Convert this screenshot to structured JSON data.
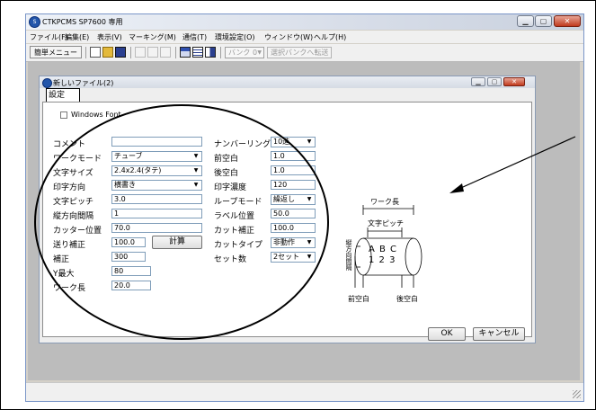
{
  "window": {
    "title": "CTKPCMS SP7600 専用",
    "controls": {
      "minimize": "▁",
      "maximize": "▢",
      "close": "✕"
    }
  },
  "menu": [
    "ファイル(F)",
    "編集(E)",
    "表示(V)",
    "マーキング(M)",
    "通信(T)",
    "環境設定(O)",
    "ウィンドウ(W)",
    "ヘルプ(H)"
  ],
  "toolbar": {
    "simple_menu": "簡単メニュー",
    "bank_select": "バンク 0",
    "transfer_button": "選択バンクへ転送"
  },
  "child_window": {
    "title": "新しいファイル(2)"
  },
  "tab": {
    "label": "設定"
  },
  "font_option": {
    "label": "Windows Font",
    "checked": false
  },
  "fields_left": [
    {
      "label": "コメント",
      "value": "",
      "kind": "text"
    },
    {
      "label": "ワークモード",
      "value": "チューブ",
      "kind": "select"
    },
    {
      "label": "文字サイズ",
      "value": "2.4x2.4(タテ)",
      "kind": "select"
    },
    {
      "label": "印字方向",
      "value": "横書き",
      "kind": "select"
    },
    {
      "label": "文字ピッチ",
      "value": "3.0",
      "kind": "text"
    },
    {
      "label": "縦方向間隔",
      "value": "1",
      "kind": "text"
    },
    {
      "label": "カッター位置",
      "value": "70.0",
      "kind": "text"
    },
    {
      "label": "送り補正",
      "value": "100.0",
      "kind": "text"
    },
    {
      "label": "補正",
      "value": "300",
      "kind": "text"
    },
    {
      "label": "Y最大",
      "value": "80",
      "kind": "text"
    },
    {
      "label": "ワーク長",
      "value": "20.0",
      "kind": "text"
    }
  ],
  "calc_button": "計算",
  "fields_right": [
    {
      "label": "ナンバーリング",
      "value": "10進",
      "kind": "select"
    },
    {
      "label": "前空白",
      "value": "1.0",
      "kind": "text"
    },
    {
      "label": "後空白",
      "value": "1.0",
      "kind": "text"
    },
    {
      "label": "印字濃度",
      "value": "120",
      "kind": "text"
    },
    {
      "label": "ループモード",
      "value": "繰返し",
      "kind": "select"
    },
    {
      "label": "ラベル位置",
      "value": "50.0",
      "kind": "text"
    },
    {
      "label": "カット補正",
      "value": "100.0",
      "kind": "text"
    },
    {
      "label": "カットタイプ",
      "value": "非動作",
      "kind": "select"
    },
    {
      "label": "セット数",
      "value": "2セット",
      "kind": "select"
    }
  ],
  "diagram": {
    "work_length": "ワーク長",
    "char_pitch": "文字ピッチ",
    "front_blank": "前空白",
    "rear_blank": "後空白",
    "vertical_spacing": "縦方向間隔",
    "sample_row1": "A B C",
    "sample_row2": "1 2 3"
  },
  "buttons": {
    "ok": "OK",
    "cancel": "キャンセル"
  },
  "icons": [
    "app-icon",
    "new-file-icon",
    "open-folder-icon",
    "save-icon",
    "cut-icon",
    "copy-icon",
    "paste-icon",
    "window-icon",
    "grid-icon",
    "panel-icon"
  ],
  "colors": {
    "annotation": "#000000",
    "titlebar": "#d7dde8",
    "client_bg": "#bcbcbc"
  }
}
